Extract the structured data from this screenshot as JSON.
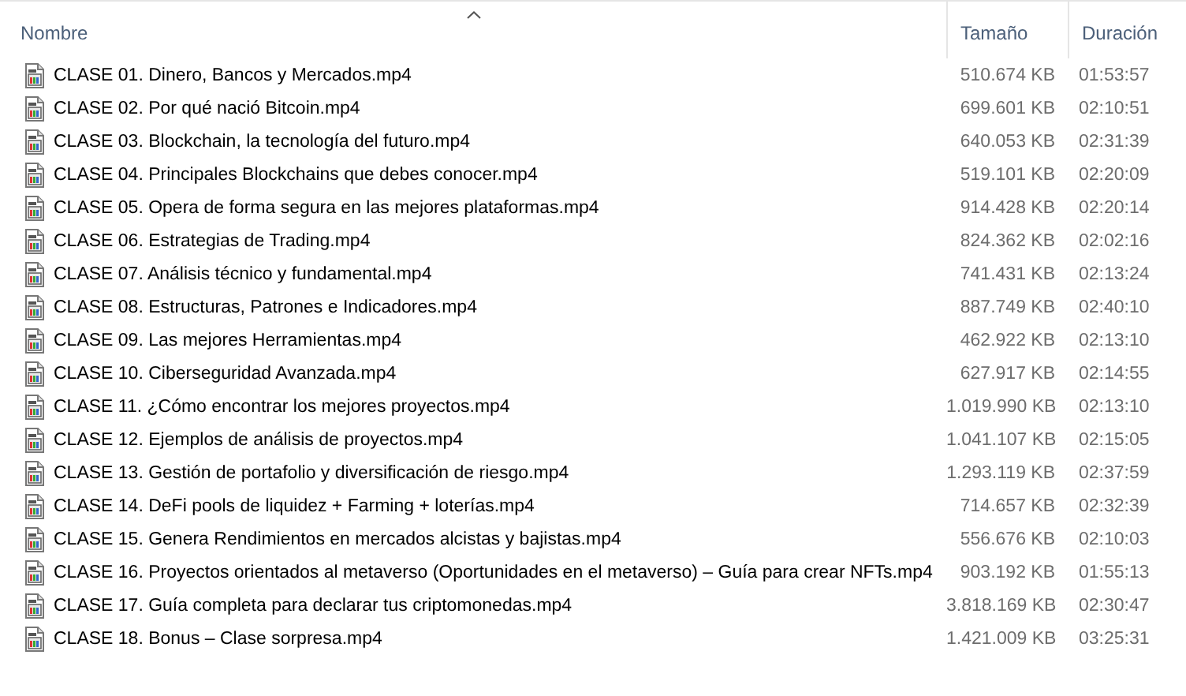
{
  "columns": [
    {
      "label": "Nombre",
      "sorted": true
    },
    {
      "label": "Tamaño",
      "sorted": false
    },
    {
      "label": "Duración",
      "sorted": false
    }
  ],
  "files": [
    {
      "name": "CLASE 01. Dinero, Bancos y Mercados.mp4",
      "size": "510.674 KB",
      "duration": "01:53:57"
    },
    {
      "name": "CLASE 02. Por qué nació Bitcoin.mp4",
      "size": "699.601 KB",
      "duration": "02:10:51"
    },
    {
      "name": "CLASE 03. Blockchain, la tecnología del futuro.mp4",
      "size": "640.053 KB",
      "duration": "02:31:39"
    },
    {
      "name": "CLASE 04. Principales Blockchains que debes conocer.mp4",
      "size": "519.101 KB",
      "duration": "02:20:09"
    },
    {
      "name": "CLASE 05. Opera de forma segura en las mejores plataformas.mp4",
      "size": "914.428 KB",
      "duration": "02:20:14"
    },
    {
      "name": "CLASE 06. Estrategias de Trading.mp4",
      "size": "824.362 KB",
      "duration": "02:02:16"
    },
    {
      "name": "CLASE 07. Análisis técnico y fundamental.mp4",
      "size": "741.431 KB",
      "duration": "02:13:24"
    },
    {
      "name": "CLASE 08. Estructuras, Patrones e Indicadores.mp4",
      "size": "887.749 KB",
      "duration": "02:40:10"
    },
    {
      "name": "CLASE 09. Las mejores Herramientas.mp4",
      "size": "462.922 KB",
      "duration": "02:13:10"
    },
    {
      "name": "CLASE 10. Ciberseguridad Avanzada.mp4",
      "size": "627.917 KB",
      "duration": "02:14:55"
    },
    {
      "name": "CLASE 11. ¿Cómo encontrar los mejores proyectos.mp4",
      "size": "1.019.990 KB",
      "duration": "02:13:10"
    },
    {
      "name": "CLASE 12. Ejemplos de análisis de proyectos.mp4",
      "size": "1.041.107 KB",
      "duration": "02:15:05"
    },
    {
      "name": "CLASE 13. Gestión de portafolio y diversificación de riesgo.mp4",
      "size": "1.293.119 KB",
      "duration": "02:37:59"
    },
    {
      "name": "CLASE 14. DeFi pools de liquidez + Farming + loterías.mp4",
      "size": "714.657 KB",
      "duration": "02:32:39"
    },
    {
      "name": "CLASE 15. Genera Rendimientos en mercados alcistas y bajistas.mp4",
      "size": "556.676 KB",
      "duration": "02:10:03"
    },
    {
      "name": "CLASE 16. Proyectos orientados al metaverso (Oportunidades en el metaverso) – Guía para crear NFTs.mp4",
      "size": "903.192 KB",
      "duration": "01:55:13"
    },
    {
      "name": "CLASE 17. Guía completa para declarar tus criptomonedas.mp4",
      "size": "3.818.169 KB",
      "duration": "02:30:47"
    },
    {
      "name": "CLASE 18. Bonus – Clase sorpresa.mp4",
      "size": "1.421.009 KB",
      "duration": "03:25:31"
    }
  ]
}
